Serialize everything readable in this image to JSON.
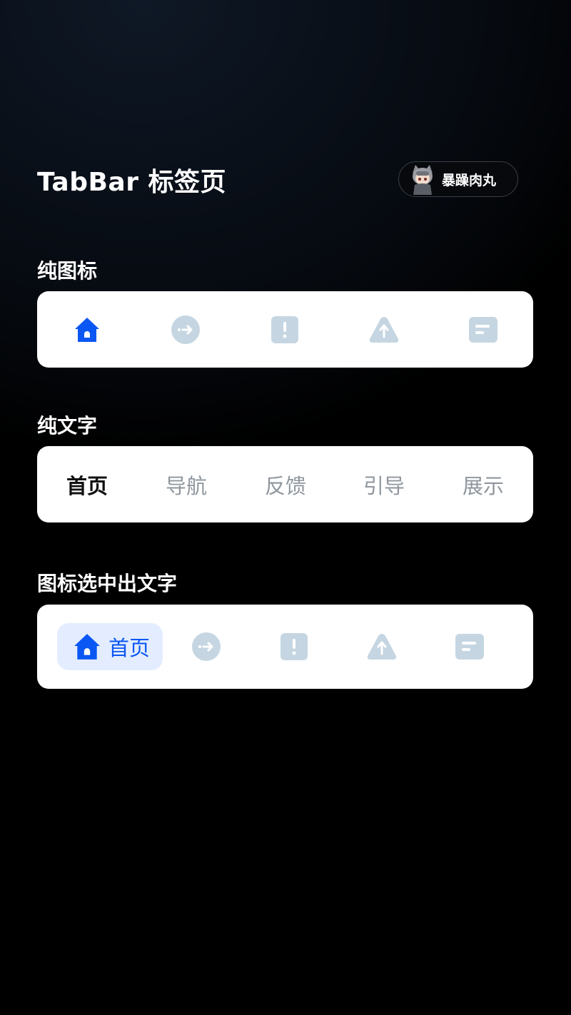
{
  "page": {
    "title": "TabBar 标签页"
  },
  "author": {
    "name": "暴躁肉丸"
  },
  "sections": [
    {
      "title": "纯图标",
      "tabs": [
        {
          "icon": "home-icon",
          "active": true
        },
        {
          "icon": "arrow-circle-icon",
          "active": false
        },
        {
          "icon": "alert-square-icon",
          "active": false
        },
        {
          "icon": "warning-triangle-icon",
          "active": false
        },
        {
          "icon": "message-square-icon",
          "active": false
        }
      ]
    },
    {
      "title": "纯文字",
      "tabs": [
        {
          "label": "首页",
          "active": true
        },
        {
          "label": "导航",
          "active": false
        },
        {
          "label": "反馈",
          "active": false
        },
        {
          "label": "引导",
          "active": false
        },
        {
          "label": "展示",
          "active": false
        }
      ]
    },
    {
      "title": "图标选中出文字",
      "tabs": [
        {
          "icon": "home-icon",
          "label": "首页",
          "active": true
        },
        {
          "icon": "arrow-circle-icon",
          "active": false
        },
        {
          "icon": "alert-square-icon",
          "active": false
        },
        {
          "icon": "warning-triangle-icon",
          "active": false
        },
        {
          "icon": "message-square-icon",
          "active": false
        }
      ]
    }
  ],
  "colors": {
    "active": "#0b57f3",
    "inactive_icon": "#c5d6e2",
    "active_pill_bg": "#e3edff",
    "inactive_text": "#8f969e",
    "card_bg": "#ffffff"
  }
}
